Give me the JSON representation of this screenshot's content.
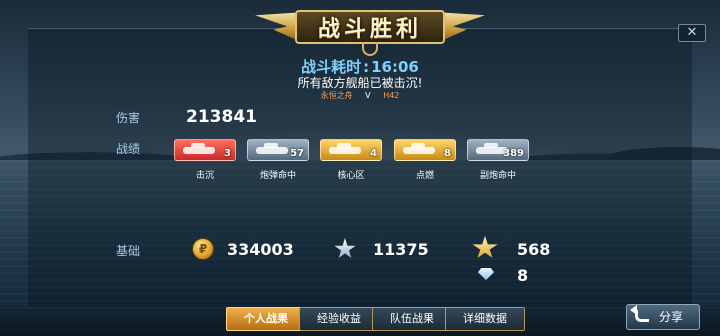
{
  "header": {
    "title": "战斗胜利",
    "battle_time_label": "战斗耗时",
    "battle_time_value": "16:06",
    "result_text": "所有敌方舰船已被击沉!",
    "map_name": "永恒之舟",
    "map_mid": "V",
    "map_code": "H42",
    "close_label": "✕"
  },
  "damage": {
    "label": "伤害",
    "value": "213841"
  },
  "achievements": {
    "label": "战绩",
    "items": [
      {
        "caption": "击沉",
        "count": "3",
        "color": "red",
        "icon": "ship-silhouette-icon"
      },
      {
        "caption": "炮弹命中",
        "count": "57",
        "color": "gray",
        "icon": "shell-icon"
      },
      {
        "caption": "核心区",
        "count": "4",
        "color": "gold",
        "icon": "citadel-icon"
      },
      {
        "caption": "点燃",
        "count": "8",
        "color": "gold",
        "icon": "fire-icon"
      },
      {
        "caption": "副炮命中",
        "count": "389",
        "color": "gray",
        "icon": "secondary-gun-icon"
      }
    ]
  },
  "base_rewards": {
    "label": "基础",
    "coin_value": "334003",
    "coin_symbol": "₽",
    "exp_value": "11375",
    "rank_value": "568",
    "diamond_value": "8"
  },
  "tabs": [
    {
      "label": "个人战果",
      "active": true
    },
    {
      "label": "经验收益",
      "active": false
    },
    {
      "label": "队伍战果",
      "active": false
    },
    {
      "label": "详细数据",
      "active": false
    }
  ],
  "share": {
    "label": "分享"
  },
  "colors": {
    "accent_blue": "#7ed0ff",
    "gold": "#e0a42c",
    "badge_red": "#c92a25",
    "active_tab": "#f0b14c"
  }
}
